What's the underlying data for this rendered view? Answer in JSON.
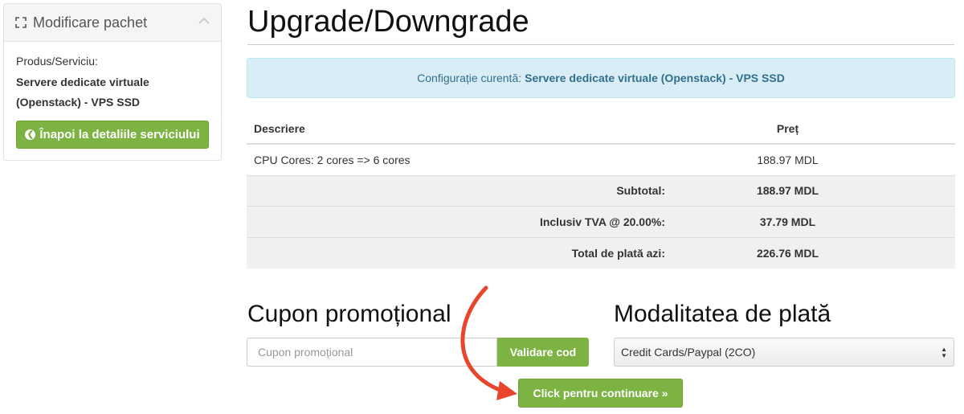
{
  "sidebar": {
    "title": "Modificare pachet",
    "product_label": "Produs/Serviciu:",
    "product_name": "Servere dedicate virtuale (Openstack) - VPS SSD",
    "back_button": "Înapoi la detaliile serviciului"
  },
  "main": {
    "title": "Upgrade/Downgrade",
    "config_label": "Configurație curentă:",
    "config_value": "Servere dedicate virtuale (Openstack) - VPS SSD"
  },
  "table": {
    "headers": [
      "Descriere",
      "Preț"
    ],
    "rows": [
      {
        "desc": "CPU Cores: 2 cores => 6 cores",
        "price": "188.97 MDL"
      }
    ],
    "summary": [
      {
        "label": "Subtotal:",
        "value": "188.97 MDL"
      },
      {
        "label": "Inclusiv TVA @ 20.00%:",
        "value": "37.79 MDL"
      },
      {
        "label": "Total de plată azi:",
        "value": "226.76 MDL"
      }
    ]
  },
  "coupon": {
    "heading": "Cupon promoțional",
    "placeholder": "Cupon promoțional",
    "button": "Validare cod"
  },
  "payment": {
    "heading": "Modalitatea de plată",
    "selected": "Credit Cards/Paypal (2CO)"
  },
  "continue_button": "Click pentru continuare »",
  "colors": {
    "accent_green": "#7cb342",
    "info_bg": "#d9edf7",
    "annotation_arrow": "#e8452c"
  }
}
